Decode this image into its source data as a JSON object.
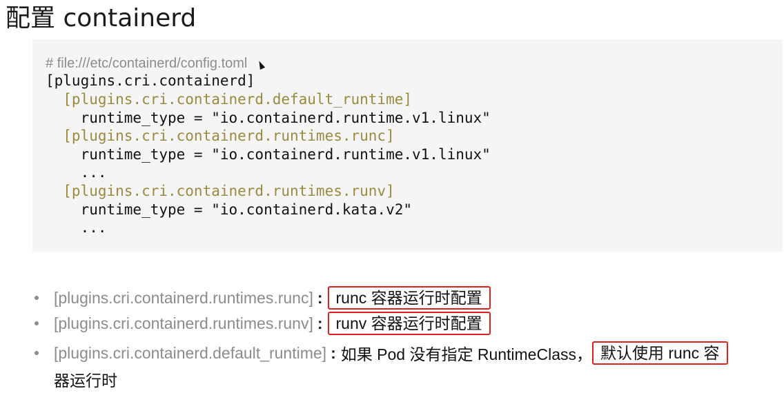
{
  "title": "配置 containerd",
  "code": {
    "comment": "# file:///etc/containerd/config.toml",
    "lines": [
      {
        "text": "[plugins.cri.containerd]",
        "kind": "plain"
      },
      {
        "text": "  [plugins.cri.containerd.default_runtime]",
        "kind": "section"
      },
      {
        "text": "    runtime_type = \"io.containerd.runtime.v1.linux\"",
        "kind": "plain"
      },
      {
        "text": "  [plugins.cri.containerd.runtimes.runc]",
        "kind": "section"
      },
      {
        "text": "    runtime_type = \"io.containerd.runtime.v1.linux\"",
        "kind": "plain"
      },
      {
        "text": "    ...",
        "kind": "plain"
      },
      {
        "text": "  [plugins.cri.containerd.runtimes.runv]",
        "kind": "section"
      },
      {
        "text": "    runtime_type = \"io.containerd.kata.v2\"",
        "kind": "plain"
      },
      {
        "text": "    ...",
        "kind": "plain"
      }
    ]
  },
  "bullets": [
    {
      "key": "[plugins.cri.containerd.runtimes.runc]",
      "colon": ":",
      "before": "",
      "highlight": "runc 容器运行时配置"
    },
    {
      "key": "[plugins.cri.containerd.runtimes.runv]",
      "colon": ":",
      "before": "",
      "highlight": "runv 容器运行时配置"
    },
    {
      "key": "[plugins.cri.containerd.default_runtime]",
      "colon": ":",
      "before": "如果 Pod 没有指定 RuntimeClass，",
      "highlight": "默认使用 runc 容"
    }
  ],
  "continuation": "器运行时",
  "colors": {
    "highlight_border": "#e02020",
    "section_text": "#9a8a3d",
    "muted_text": "#8c8c8c",
    "code_bg": "#f5f5f5"
  }
}
